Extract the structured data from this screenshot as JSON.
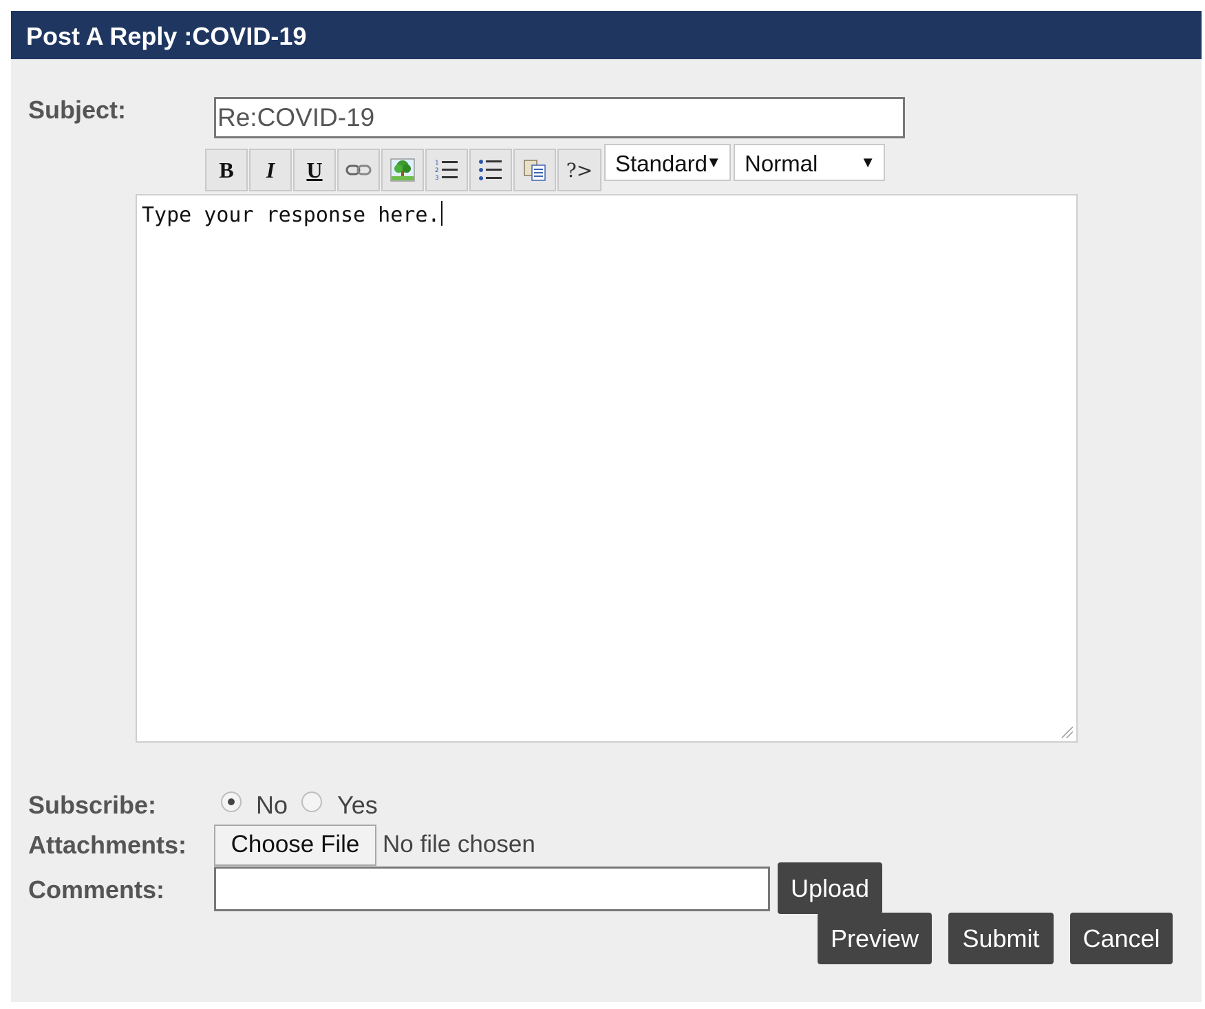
{
  "header": {
    "title": "Post A Reply :COVID-19"
  },
  "subject": {
    "label": "Subject:",
    "value": "Re:COVID-19"
  },
  "toolbar": {
    "buttons": [
      {
        "name": "bold",
        "icon": "bold-icon",
        "glyph": "B"
      },
      {
        "name": "italic",
        "icon": "italic-icon",
        "glyph": "I"
      },
      {
        "name": "underline",
        "icon": "underline-icon",
        "glyph": "U"
      },
      {
        "name": "link",
        "icon": "link-icon"
      },
      {
        "name": "image",
        "icon": "image-icon"
      },
      {
        "name": "ordered-list",
        "icon": "ordered-list-icon"
      },
      {
        "name": "unordered-list",
        "icon": "unordered-list-icon"
      },
      {
        "name": "paste",
        "icon": "paste-icon"
      },
      {
        "name": "code",
        "icon": "code-icon",
        "glyph": "?>"
      }
    ],
    "font_select": {
      "value": "Standard"
    },
    "size_select": {
      "value": "Normal"
    },
    "dropdown_arrow": "▼"
  },
  "editor": {
    "text": "Type your response here."
  },
  "subscribe": {
    "label": "Subscribe:",
    "options": [
      {
        "label": "No",
        "selected": true
      },
      {
        "label": "Yes",
        "selected": false
      }
    ]
  },
  "attachments": {
    "label": "Attachments:",
    "choose_file_label": "Choose File",
    "status": "No file chosen"
  },
  "comments": {
    "label": "Comments:",
    "value": ""
  },
  "buttons": {
    "upload": "Upload",
    "preview": "Preview",
    "submit": "Submit",
    "cancel": "Cancel"
  },
  "colors": {
    "header_bg": "#1f3661",
    "panel_bg": "#eeeeee",
    "button_bg": "#444444"
  }
}
